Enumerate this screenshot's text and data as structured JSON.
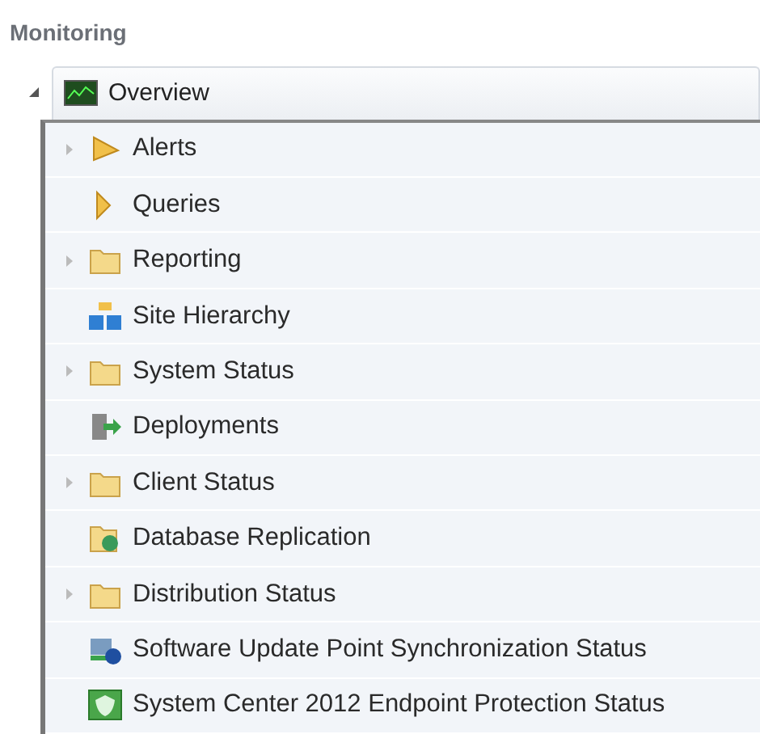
{
  "header": {
    "title": "Monitoring"
  },
  "tree": {
    "label": "Overview",
    "kind": "overview",
    "expanded": true,
    "children": [
      {
        "label": "Alerts",
        "kind": "alert",
        "has_children": true
      },
      {
        "label": "Queries",
        "kind": "query",
        "has_children": false
      },
      {
        "label": "Reporting",
        "kind": "folder",
        "has_children": true
      },
      {
        "label": "Site Hierarchy",
        "kind": "hierarchy",
        "has_children": false
      },
      {
        "label": "System Status",
        "kind": "folder",
        "has_children": true
      },
      {
        "label": "Deployments",
        "kind": "deployment",
        "has_children": false
      },
      {
        "label": "Client Status",
        "kind": "folder",
        "has_children": true
      },
      {
        "label": "Database Replication",
        "kind": "database",
        "has_children": false
      },
      {
        "label": "Distribution Status",
        "kind": "folder",
        "has_children": true
      },
      {
        "label": "Software Update Point Synchronization Status",
        "kind": "update",
        "has_children": false
      },
      {
        "label": "System Center 2012 Endpoint Protection Status",
        "kind": "endpoint",
        "has_children": false
      }
    ]
  }
}
